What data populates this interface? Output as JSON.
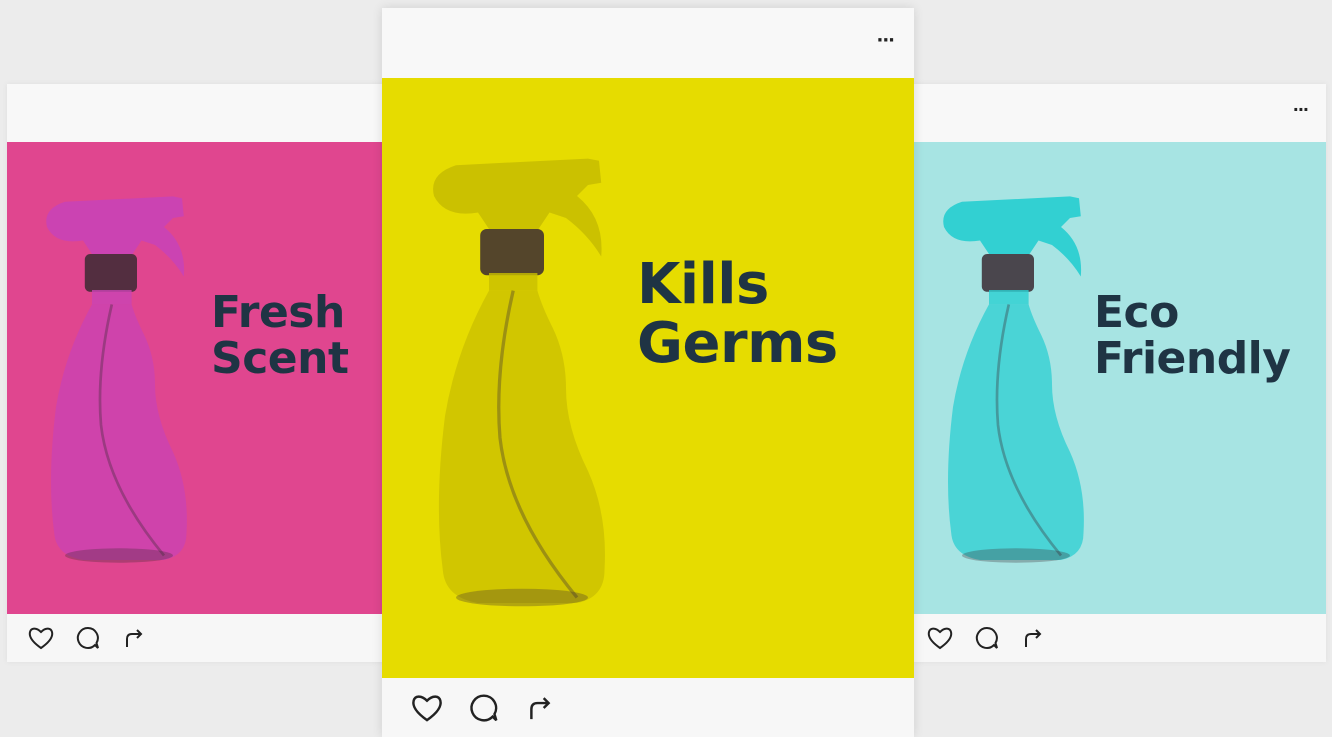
{
  "posts": [
    {
      "id": "left",
      "caption_line1": "Fresh",
      "caption_line2": "Scent",
      "bg_color": "#e0468f",
      "bottle_color": "#c943b4",
      "menu_label": "···"
    },
    {
      "id": "center",
      "caption_line1": "Kills",
      "caption_line2": "Germs",
      "bg_color": "#e6dc00",
      "bottle_color": "#c9bf00",
      "menu_label": "···"
    },
    {
      "id": "right",
      "caption_line1": "Eco",
      "caption_line2": "Friendly",
      "bg_color": "#a7e4e3",
      "bottle_color": "#2bcfd1",
      "menu_label": "···"
    }
  ],
  "icons": {
    "like": "heart-icon",
    "comment": "comment-icon",
    "share": "share-icon",
    "menu": "more-options-icon"
  },
  "colors": {
    "page_bg": "#ececec",
    "card_bg": "#f7f7f7",
    "caption_text": "#1f3444"
  }
}
